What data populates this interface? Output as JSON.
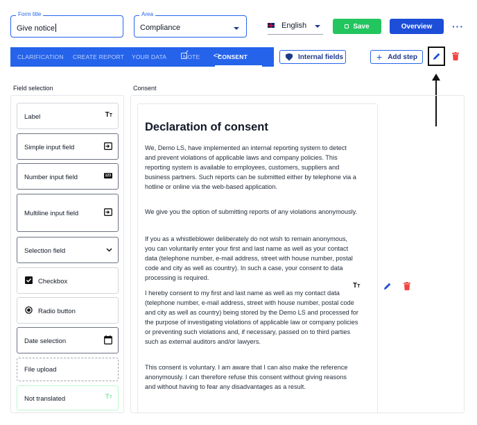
{
  "form": {
    "title_label": "Form title",
    "title_value": "Give notice",
    "area_label": "Area",
    "area_value": "Compliance"
  },
  "header": {
    "language": "English",
    "save_label": "Save",
    "overview_label": "Overview",
    "more_label": "···"
  },
  "tabs": [
    {
      "label": "CLARIFICATION"
    },
    {
      "label": "CREATE REPORT"
    },
    {
      "label": "YOUR DATA"
    },
    {
      "label": "NOTE"
    },
    {
      "label": "CONSENT"
    }
  ],
  "toolbar": {
    "internal_fields_label": "Internal fields",
    "add_step_label": "Add step"
  },
  "sections": {
    "field_selection": "Field selection",
    "consent": "Consent"
  },
  "field_items": [
    {
      "label": "Label",
      "icon": "text-size-icon"
    },
    {
      "label": "Simple input field",
      "icon": "input-icon"
    },
    {
      "label": "Number input field",
      "icon": "number-icon",
      "icon_text": "123"
    },
    {
      "label": "Multiline input field",
      "icon": "input-icon"
    },
    {
      "label": "Selection field",
      "icon": "chevron-down-icon"
    },
    {
      "label": "Checkbox",
      "icon": "checkbox-icon"
    },
    {
      "label": "Radio button",
      "icon": "radio-icon"
    },
    {
      "label": "Date selection",
      "icon": "calendar-icon"
    },
    {
      "label": "File upload",
      "icon": ""
    },
    {
      "label": "Not translated",
      "icon": "text-size-icon"
    }
  ],
  "consent_doc": {
    "heading": "Declaration of consent",
    "p1": "We, Demo LS, have implemented an internal reporting system to detect and prevent violations of applicable laws and company policies. This reporting system is available to employees, customers, suppliers and business partners. Such reports can be submitted either by telephone via a hotline or online via the web-based application.",
    "p2": "We give you the option of submitting reports of any violations anonymously.",
    "p3": "If you as a whistleblower deliberately do not wish to remain anonymous, you can voluntarily enter your first and last name as well as your contact data (telephone number, e-mail address, street with house number, postal code and city as well as country). In such a case, your consent to data processing is required.",
    "p4": "I hereby consent to my first and last name as well as my contact data (telephone number, e-mail address, street with house number, postal code and city as well as country) being stored by the Demo LS and processed for the purpose of investigating violations of applicable law or company policies or preventing such violations and, if necessary, passed on to third parties such as external auditors and/or lawyers.",
    "p5": "This consent is voluntary. I am aware that I can also make the reference anonymously. I can therefore refuse this consent without giving reasons and without having to fear any disadvantages as a result."
  },
  "colors": {
    "primary": "#2563eb",
    "save_green": "#22c55e",
    "danger": "#ef4444"
  }
}
